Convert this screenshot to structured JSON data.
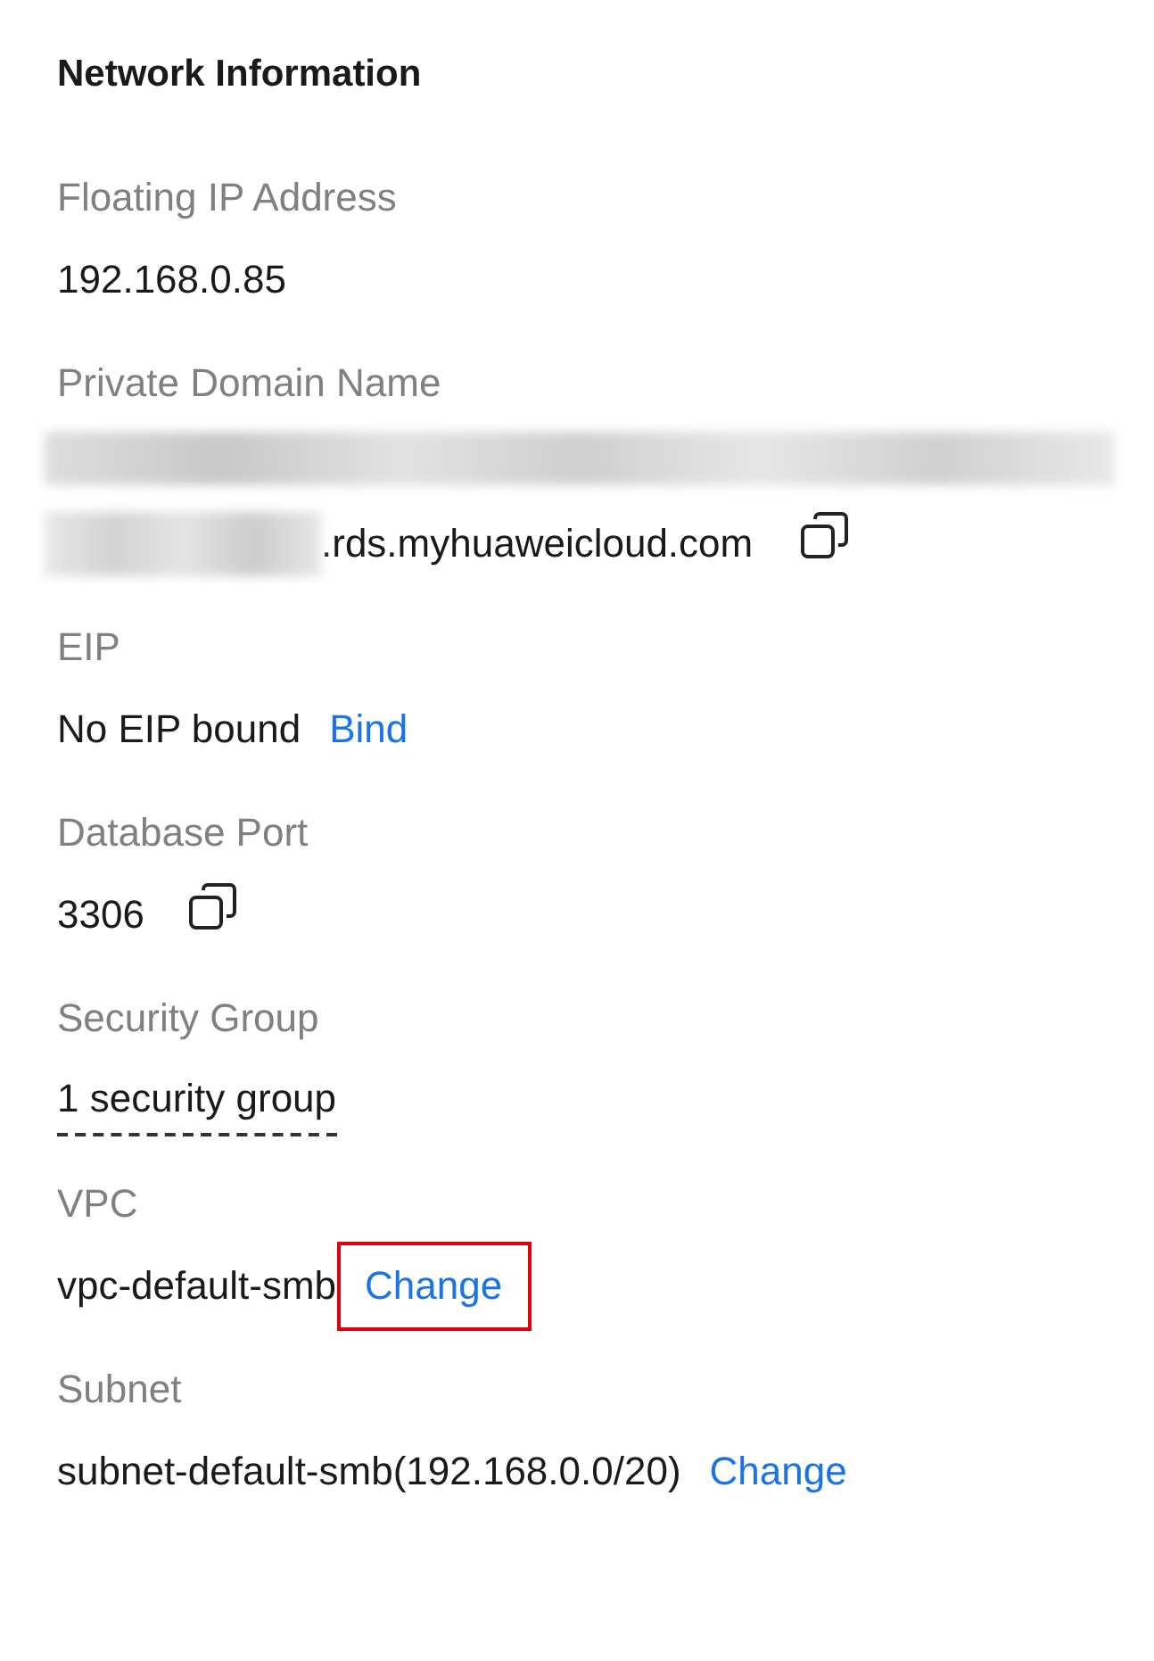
{
  "title": "Network Information",
  "fields": [
    {
      "label": "Floating IP Address",
      "value": "192.168.0.85",
      "kind": "text"
    },
    {
      "label": "Private Domain Name",
      "value": ".rds.myhuaweicloud.com",
      "kind": "redacted-copy"
    },
    {
      "label": "EIP",
      "value": "No EIP bound",
      "kind": "action",
      "action": {
        "label": "Bind",
        "highlighted": false
      }
    },
    {
      "label": "Database Port",
      "value": "3306",
      "kind": "copy"
    },
    {
      "label": "Security Group",
      "value": "1 security group",
      "kind": "dashed"
    },
    {
      "label": "VPC",
      "value": "vpc-default-smb",
      "kind": "action",
      "action": {
        "label": "Change",
        "highlighted": true
      }
    },
    {
      "label": "Subnet",
      "value": "subnet-default-smb(192.168.0.0/20)",
      "kind": "action",
      "action": {
        "label": "Change",
        "highlighted": false
      }
    }
  ]
}
